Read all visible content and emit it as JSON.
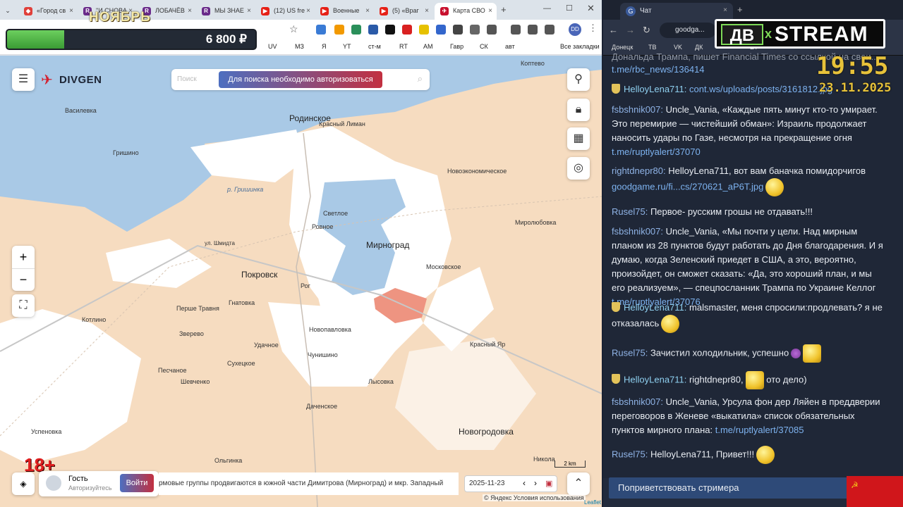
{
  "left_browser": {
    "tabs": [
      {
        "title": "«Город св",
        "favicon": "dzen-icon",
        "color": "#e0403a"
      },
      {
        "title": "\"И СНОВА",
        "favicon": "r-icon",
        "color": "#6a2a8a"
      },
      {
        "title": "ЛОБАЧЁВ",
        "favicon": "r-icon",
        "color": "#6a2a8a"
      },
      {
        "title": "МЫ ЗНАЕ",
        "favicon": "r-icon",
        "color": "#6a2a8a"
      },
      {
        "title": "(12) US fre",
        "favicon": "youtube-icon",
        "color": "#e62117"
      },
      {
        "title": "Военные",
        "favicon": "youtube-icon",
        "color": "#e62117"
      },
      {
        "title": "(5) «Враг",
        "favicon": "youtube-icon",
        "color": "#e62117"
      },
      {
        "title": "Карта СВО",
        "favicon": "divgen-icon",
        "color": "#c8102e"
      }
    ],
    "bookmarks": [
      "UV",
      "МЗ",
      "Я",
      "YT",
      "ст-м",
      "RT",
      "AM",
      "Гавр",
      "СК",
      "авт",
      "Все закладки"
    ],
    "promo": {
      "title": "НОЯБРЬ",
      "amount": "6 800 ₽",
      "progress": 0.23
    },
    "map": {
      "brand": "DIVGEN",
      "search_placeholder": "Поиск",
      "auth_banner": "Для поиска необходимо авторизоваться",
      "labels": [
        {
          "text": "Родинское",
          "kind": "city"
        },
        {
          "text": "Коптево",
          "kind": "village"
        },
        {
          "text": "Василевка",
          "kind": "village"
        },
        {
          "text": "Красный Лиман",
          "kind": "village"
        },
        {
          "text": "Гришино",
          "kind": "village"
        },
        {
          "text": "Новоэкономическое",
          "kind": "village"
        },
        {
          "text": "р. Гришинка",
          "kind": "river"
        },
        {
          "text": "Светлое",
          "kind": "village"
        },
        {
          "text": "Ровное",
          "kind": "village"
        },
        {
          "text": "Мирноград",
          "kind": "city"
        },
        {
          "text": "Миролюбовка",
          "kind": "village"
        },
        {
          "text": "ул. Шмидта",
          "kind": "street"
        },
        {
          "text": "Покровск",
          "kind": "city"
        },
        {
          "text": "Московское",
          "kind": "village"
        },
        {
          "text": "Рог",
          "kind": "village"
        },
        {
          "text": "Гнатовка",
          "kind": "village"
        },
        {
          "text": "Котлино",
          "kind": "village"
        },
        {
          "text": "Перше Травня",
          "kind": "village"
        },
        {
          "text": "Новопавловка",
          "kind": "village"
        },
        {
          "text": "Зверево",
          "kind": "village"
        },
        {
          "text": "Красный Яр",
          "kind": "village"
        },
        {
          "text": "Удачное",
          "kind": "village"
        },
        {
          "text": "Чунишино",
          "kind": "village"
        },
        {
          "text": "Песчаное",
          "kind": "village"
        },
        {
          "text": "Сухецкое",
          "kind": "village"
        },
        {
          "text": "Шевченко",
          "kind": "village"
        },
        {
          "text": "Лысовка",
          "kind": "village"
        },
        {
          "text": "Успеновка",
          "kind": "village"
        },
        {
          "text": "Даченское",
          "kind": "village"
        },
        {
          "text": "Новогродовка",
          "kind": "city"
        },
        {
          "text": "Никола",
          "kind": "village"
        },
        {
          "text": "Ольгинка",
          "kind": "village"
        }
      ],
      "scale": "2 km",
      "age_badge": "18+",
      "guest_name": "Гость",
      "guest_status": "Авторизуйтесь",
      "login_button": "Войти",
      "ticker": "рмовые группы продвигаются в южной части Димитрова (Мирноград) и мкр. Западный",
      "date": "2025-11-23",
      "attribution": "© Яндекс Условия использования",
      "leaflet": "Leaflet"
    }
  },
  "right_browser": {
    "tab_title": "Чат",
    "url": "goodga...",
    "bookmarks": [
      "Донецк",
      "ТВ",
      "VK",
      "ДК",
      "ЕТ"
    ],
    "logo": {
      "left": "ДВ",
      "x": "x",
      "right": "STREAM"
    },
    "clock": {
      "time": "19:55",
      "date": "23.11.2025"
    },
    "messages": [
      {
        "nick": "",
        "text": "Дональда Трампа, пишет Financial Times со ссылкой на свои...",
        "link": "t.me/rbc_news/136414",
        "vip": false
      },
      {
        "nick": "HelloyLena711:",
        "text": "",
        "link": "cont.ws/uploads/posts/3161812.jpg",
        "vip": true
      },
      {
        "nick": "fsbshnik007:",
        "text": "Uncle_Vania, «Каждые пять минут кто-то умирает. Это перемирие — чистейший обман»: Израиль продолжает наносить удары по Газе, несмотря на прекращение огня",
        "link": "t.me/ruptlyalert/37070",
        "vip": false
      },
      {
        "nick": "rightdnepr80:",
        "text": "HelloyLena711, вот вам баначка помидорчигов",
        "link": "goodgame.ru/fi...cs/270621_aP6T.jpg",
        "vip": false
      },
      {
        "nick": "Rusel75:",
        "text": "Первое- русским грошы не отдавать!!!",
        "link": "",
        "vip": false
      },
      {
        "nick": "fsbshnik007:",
        "text": "Uncle_Vania, «Мы почти у цели. Над мирным планом из 28 пунктов будут работать до Дня благодарения. И я думаю, когда Зеленский приедет в США, а это, вероятно, произойдет, он сможет сказать: «Да, это хороший план, и мы его реализуем», — спецпосланник Трампа по Украине Келлог",
        "link": "t.me/ruptlyalert/37076",
        "vip": false
      },
      {
        "nick": "HelloyLena711:",
        "text": "malsmaster, меня спросили:продлевать? я не отказалась",
        "link": "",
        "vip": true
      },
      {
        "nick": "Rusel75:",
        "text": "Зачистил холодильник, успешно",
        "link": "",
        "vip": false
      },
      {
        "nick": "HelloyLena711:",
        "text": "rightdnepr80,",
        "tail": "ото дело)",
        "link": "",
        "vip": true
      },
      {
        "nick": "fsbshnik007:",
        "text": "Uncle_Vania, Урсула фон дер Ляйен в преддверии переговоров в Женеве «выкатила» список обязательных пунктов мирного плана:",
        "link": "t.me/ruptlyalert/37085",
        "vip": false
      },
      {
        "nick": "Rusel75:",
        "text": "HelloyLena711, Привет!!!",
        "link": "",
        "vip": false
      }
    ],
    "greet_button": "Поприветствовать стримера"
  }
}
